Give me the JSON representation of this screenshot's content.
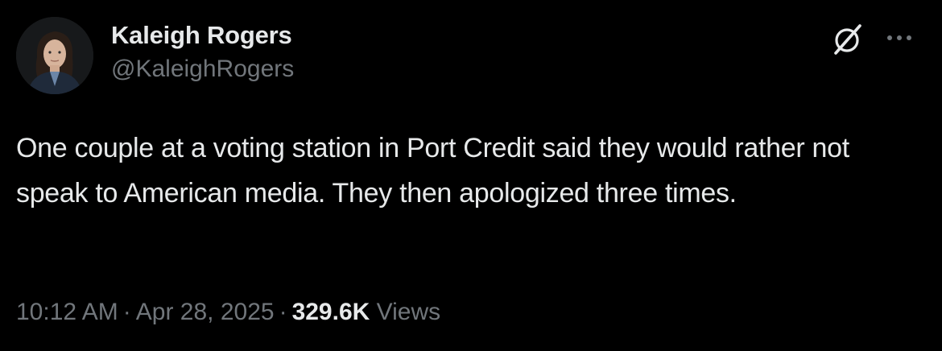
{
  "author": {
    "display_name": "Kaleigh Rogers",
    "handle": "@KaleighRogers",
    "avatar_icon": "profile-photo"
  },
  "actions": {
    "grok_icon": "grok-icon",
    "more_icon": "more-dots-icon"
  },
  "tweet": {
    "text": "One couple at a voting station in Port Credit said they would rather not speak to American media. They then apologized three times."
  },
  "meta": {
    "time": "10:12 AM",
    "separator": "·",
    "date": "Apr 28, 2025",
    "views_count": "329.6K",
    "views_label": "Views"
  },
  "colors": {
    "background": "#000000",
    "primary_text": "#e7e9ea",
    "secondary_text": "#71767b"
  }
}
